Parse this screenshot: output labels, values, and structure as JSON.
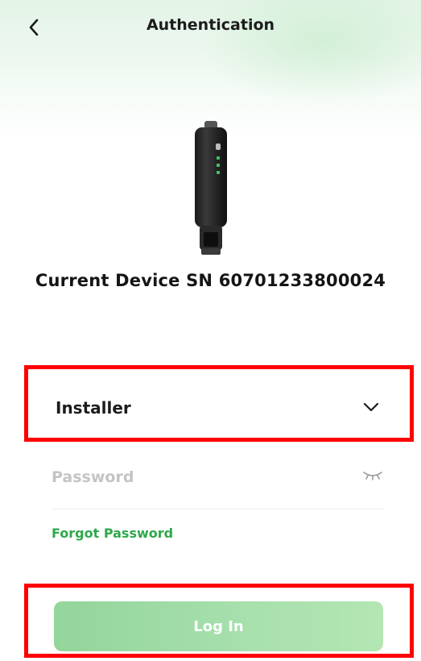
{
  "header": {
    "title": "Authentication",
    "back_icon": "chevron-left-icon"
  },
  "device": {
    "image_name": "wifi-dongle-device",
    "sn_line": "Current Device SN 60701233800024"
  },
  "form": {
    "role_select": {
      "value": "Installer",
      "icon": "chevron-down-icon"
    },
    "password": {
      "placeholder": "Password",
      "value": "",
      "toggle_icon": "eye-closed-icon"
    },
    "forgot_password_label": "Forgot Password",
    "login_label": "Log In"
  },
  "colors": {
    "accent_green": "#2ea84a",
    "login_button": "#a8e0ae",
    "highlight_box": "#ff0000",
    "header_tint": "#e3f4e7"
  }
}
